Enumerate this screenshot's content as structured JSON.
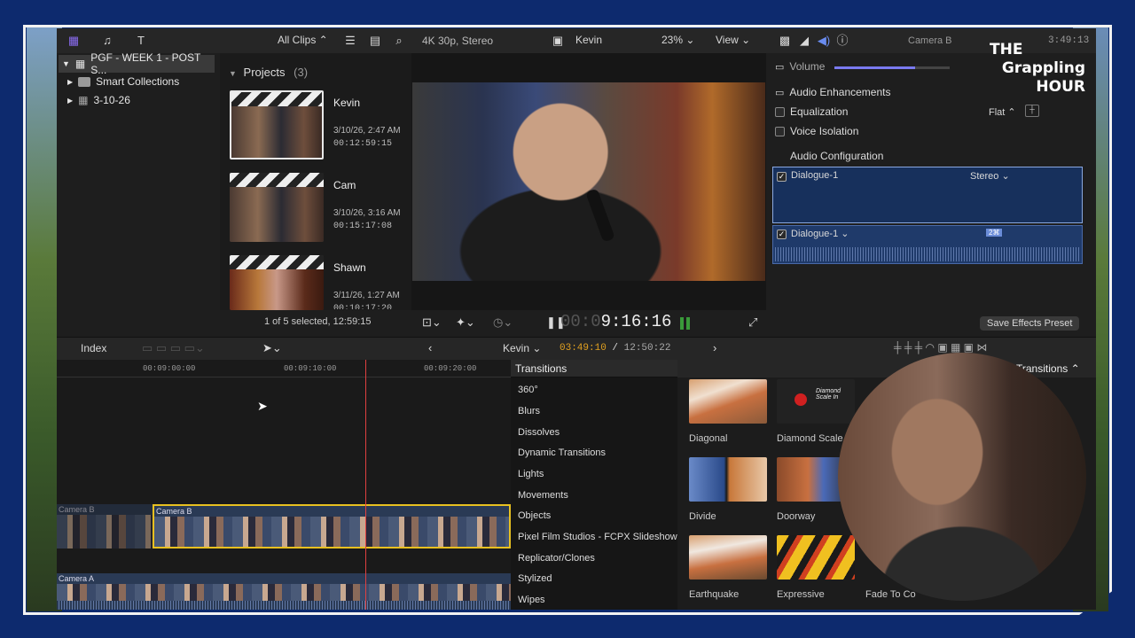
{
  "toolbar": {
    "all_clips": "All Clips",
    "format": "4K 30p, Stereo",
    "project_name": "Kevin",
    "zoom": "23%",
    "view": "View"
  },
  "sidebar": {
    "library": "PGF - WEEK 1 - POST S...",
    "items": [
      {
        "label": "Smart Collections"
      },
      {
        "label": "3-10-26"
      }
    ]
  },
  "browser": {
    "header": "Projects",
    "count": "(3)",
    "projects": [
      {
        "name": "Kevin",
        "date": "3/10/26, 2:47 AM",
        "duration": "00:12:59:15"
      },
      {
        "name": "Cam",
        "date": "3/10/26, 3:16 AM",
        "duration": "00:15:17:08"
      },
      {
        "name": "Shawn",
        "date": "3/11/26, 1:27 AM",
        "duration": "00:10:17:20"
      }
    ],
    "status": "1 of 5 selected, 12:59:15"
  },
  "viewer": {
    "timecode_dim": "00:0",
    "timecode": "9:16:16"
  },
  "inspector": {
    "camera": "Camera B",
    "time": "3:49:13",
    "volume_label": "Volume",
    "volume_level": 0.7,
    "enhancements": "Audio Enhancements",
    "equalization": "Equalization",
    "eq_value": "Flat",
    "voice_isolation": "Voice Isolation",
    "config": "Audio Configuration",
    "dialogue1": "Dialogue-1",
    "stereo": "Stereo",
    "dialogue2": "Dialogue-1",
    "badge": "2",
    "save_preset": "Save Effects Preset"
  },
  "timeline_bar": {
    "index": "Index",
    "project": "Kevin",
    "position": "03:49:10",
    "total": "12:50:22"
  },
  "ruler": {
    "t1": "00:09:00:00",
    "t2": "00:09:10:00",
    "t3": "00:09:20:00"
  },
  "clips": {
    "camera_b_left": "Camera B",
    "camera_b": "Camera B",
    "camera_a": "Camera A"
  },
  "transitions": {
    "header": "Transitions",
    "categories": [
      "360°",
      "Blurs",
      "Dissolves",
      "Dynamic Transitions",
      "Lights",
      "Movements",
      "Objects",
      "Pixel Film Studios - FCPX Slideshow",
      "Replicator/Clones",
      "Stylized",
      "Wipes"
    ],
    "grid_header": "Transitions",
    "items": [
      {
        "name": "Diagonal"
      },
      {
        "name": "Diamond Scale I"
      },
      {
        "name": "Divide"
      },
      {
        "name": "Doorway"
      },
      {
        "name": "Earthquake"
      },
      {
        "name": "Expressive"
      },
      {
        "name": "Fade To Co"
      }
    ],
    "diamond_text": "Diamond Scale In"
  },
  "logo": {
    "line1": "THE",
    "line2": "Grappling",
    "line3": "HOUR"
  }
}
